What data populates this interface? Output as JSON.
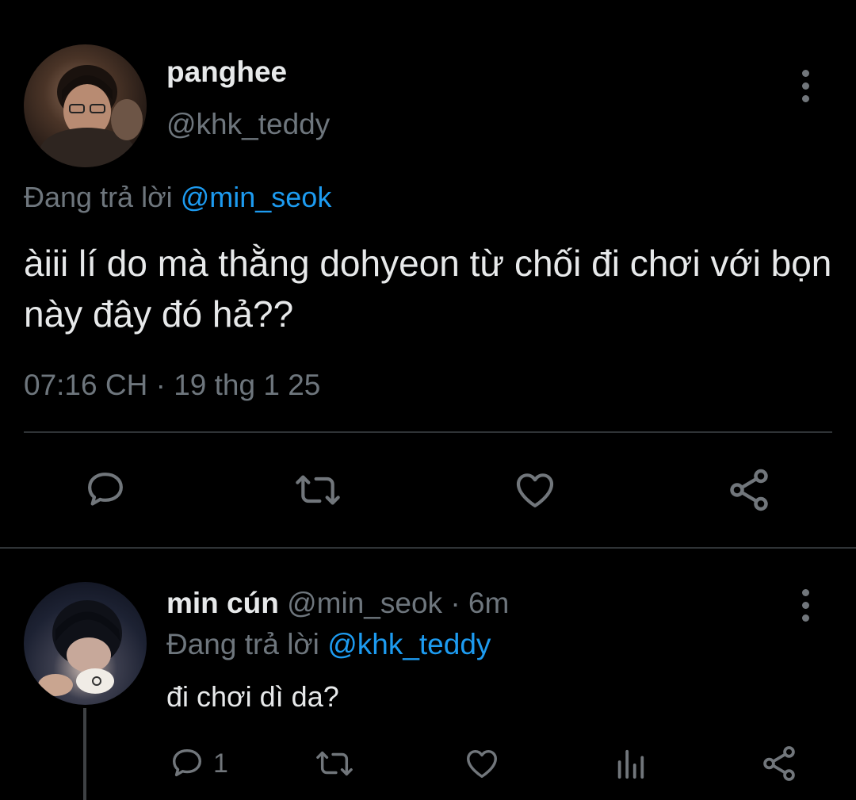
{
  "tweet": {
    "display_name": "panghee",
    "handle": "@khk_teddy",
    "replying_prefix": "Đang trả lời",
    "replying_to": "@min_seok",
    "text": "àiii lí do mà thằng dohyeon từ chối đi chơi với bọn này đây đó hả??",
    "timestamp": "07:16 CH · 19 thg 1 25"
  },
  "reply": {
    "display_name": "min cún",
    "handle": "@min_seok",
    "time": "· 6m",
    "replying_prefix": "Đang trả lời",
    "replying_to": "@khk_teddy",
    "text": "đi chơi dì da?",
    "reply_count": "1"
  },
  "icons": [
    "reply-icon",
    "retweet-icon",
    "like-icon",
    "share-icon",
    "views-icon",
    "more-icon"
  ],
  "colors": {
    "background": "#000000",
    "text": "#e7e9ea",
    "muted": "#6e767d",
    "link": "#1d9bf0",
    "divider": "#2f3336"
  }
}
